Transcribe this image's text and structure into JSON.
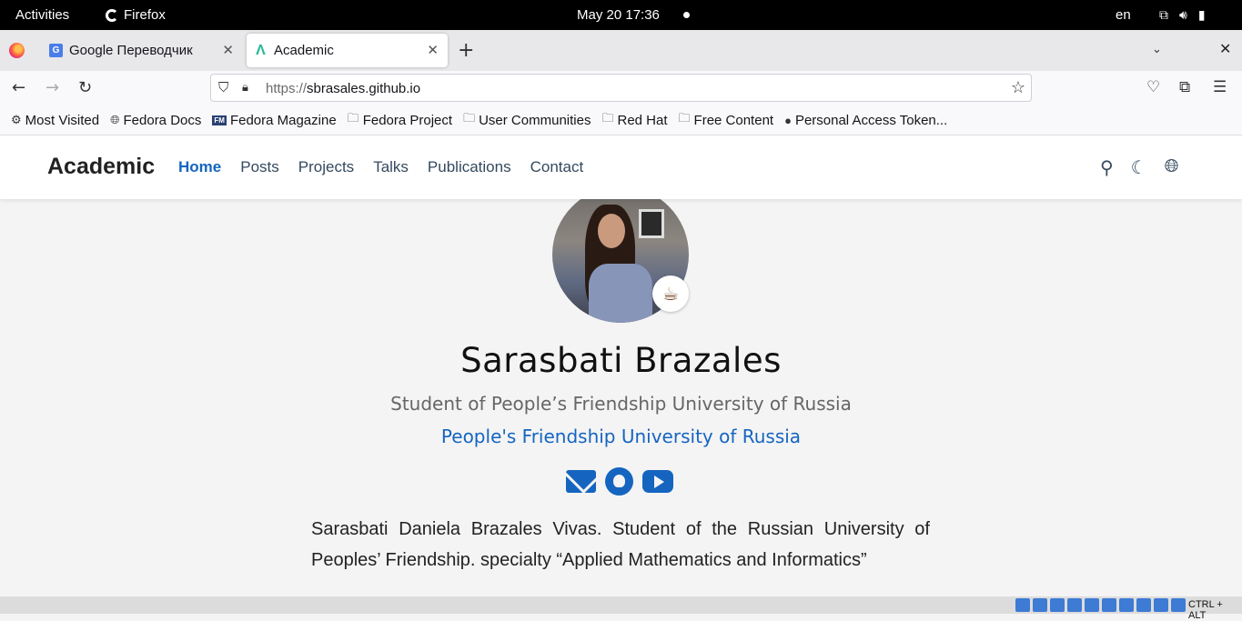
{
  "system": {
    "activities": "Activities",
    "app_name": "Firefox",
    "clock": "May 20  17:36",
    "lang": "en"
  },
  "browser": {
    "tabs": [
      {
        "label": "Google Переводчик",
        "favicon": "google-translate-icon"
      },
      {
        "label": "Academic",
        "favicon": "academic-icon"
      }
    ],
    "url_scheme": "https://",
    "url_host": "sbrasales.github.io",
    "bookmarks": [
      {
        "label": "Most Visited",
        "icon": "gear-icon"
      },
      {
        "label": "Fedora Docs",
        "icon": "globe-icon"
      },
      {
        "label": "Fedora Magazine",
        "icon": "fm-icon"
      },
      {
        "label": "Fedora Project",
        "icon": "folder-icon"
      },
      {
        "label": "User Communities",
        "icon": "folder-icon"
      },
      {
        "label": "Red Hat",
        "icon": "folder-icon"
      },
      {
        "label": "Free Content",
        "icon": "folder-icon"
      },
      {
        "label": "Personal Access Token...",
        "icon": "github-icon"
      }
    ]
  },
  "site": {
    "brand": "Academic",
    "menu": [
      "Home",
      "Posts",
      "Projects",
      "Talks",
      "Publications",
      "Contact"
    ],
    "active_menu": "Home",
    "accent_color": "#1565c0"
  },
  "profile": {
    "name": "Sarasbati Brazales",
    "role": "Student of People’s Friendship University of Russia",
    "organization": "People's Friendship University of Russia",
    "status_emoji": "☕",
    "social": [
      "email-icon",
      "github-icon",
      "youtube-icon"
    ],
    "bio": "Sarasbati Daniela Brazales Vivas. Student of the Russian University of Peoples’ Friendship. specialty “Applied Mathematics and Informatics”"
  },
  "vm": {
    "hostkey": "CTRL + ALT"
  }
}
